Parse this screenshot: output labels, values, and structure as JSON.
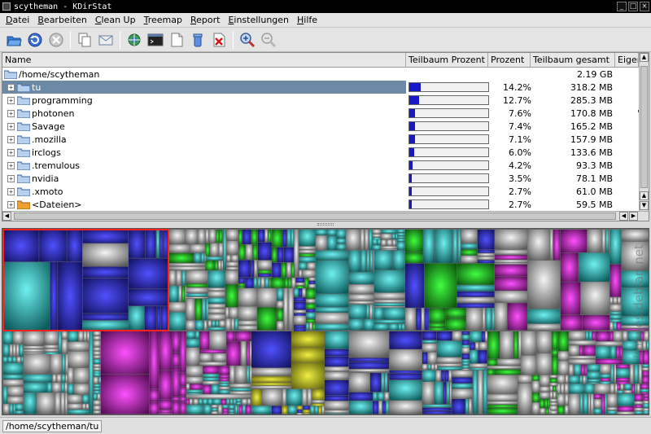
{
  "window": {
    "title": "scytheman - KDirStat"
  },
  "menu": [
    "Datei",
    "Bearbeiten",
    "Clean Up",
    "Treemap",
    "Report",
    "Einstellungen",
    "Hilfe"
  ],
  "toolbar_icons": [
    "open-folder-icon",
    "refresh-icon",
    "stop-icon",
    "copy-icon",
    "mail-icon",
    "network-icon",
    "terminal-icon",
    "document-icon",
    "trash-icon",
    "delete-icon",
    "zoom-in-icon",
    "zoom-out-icon"
  ],
  "columns": [
    "Name",
    "Teilbaum Prozent",
    "Prozent",
    "Teilbaum gesamt",
    "Eigen"
  ],
  "root": {
    "path": "/home/scytheman",
    "size": "2.19 GB"
  },
  "rows": [
    {
      "name": "tu",
      "percent": "14.2%",
      "fraction": 0.142,
      "size": "318.2 MB",
      "selected": true
    },
    {
      "name": "programming",
      "percent": "12.7%",
      "fraction": 0.127,
      "size": "285.3 MB"
    },
    {
      "name": "photonen",
      "percent": "7.6%",
      "fraction": 0.076,
      "size": "170.8 MB",
      "extra": "'"
    },
    {
      "name": "Savage",
      "percent": "7.4%",
      "fraction": 0.074,
      "size": "165.2 MB"
    },
    {
      "name": ".mozilla",
      "percent": "7.1%",
      "fraction": 0.071,
      "size": "157.9 MB"
    },
    {
      "name": "irclogs",
      "percent": "6.0%",
      "fraction": 0.06,
      "size": "133.6 MB"
    },
    {
      "name": ".tremulous",
      "percent": "4.2%",
      "fraction": 0.042,
      "size": "93.3 MB"
    },
    {
      "name": "nvidia",
      "percent": "3.5%",
      "fraction": 0.035,
      "size": "78.1 MB"
    },
    {
      "name": ".xmoto",
      "percent": "2.7%",
      "fraction": 0.027,
      "size": "61.0 MB"
    },
    {
      "name": "<Dateien>",
      "percent": "2.7%",
      "fraction": 0.027,
      "size": "59.5 MB",
      "files": true
    }
  ],
  "statusbar": {
    "path": "/home/scytheman/tu"
  },
  "watermark": "images.debian.net",
  "colors": {
    "selection": "#6c8aa6",
    "bar_fill": "#1818c8",
    "highlight": "#ff2020"
  }
}
